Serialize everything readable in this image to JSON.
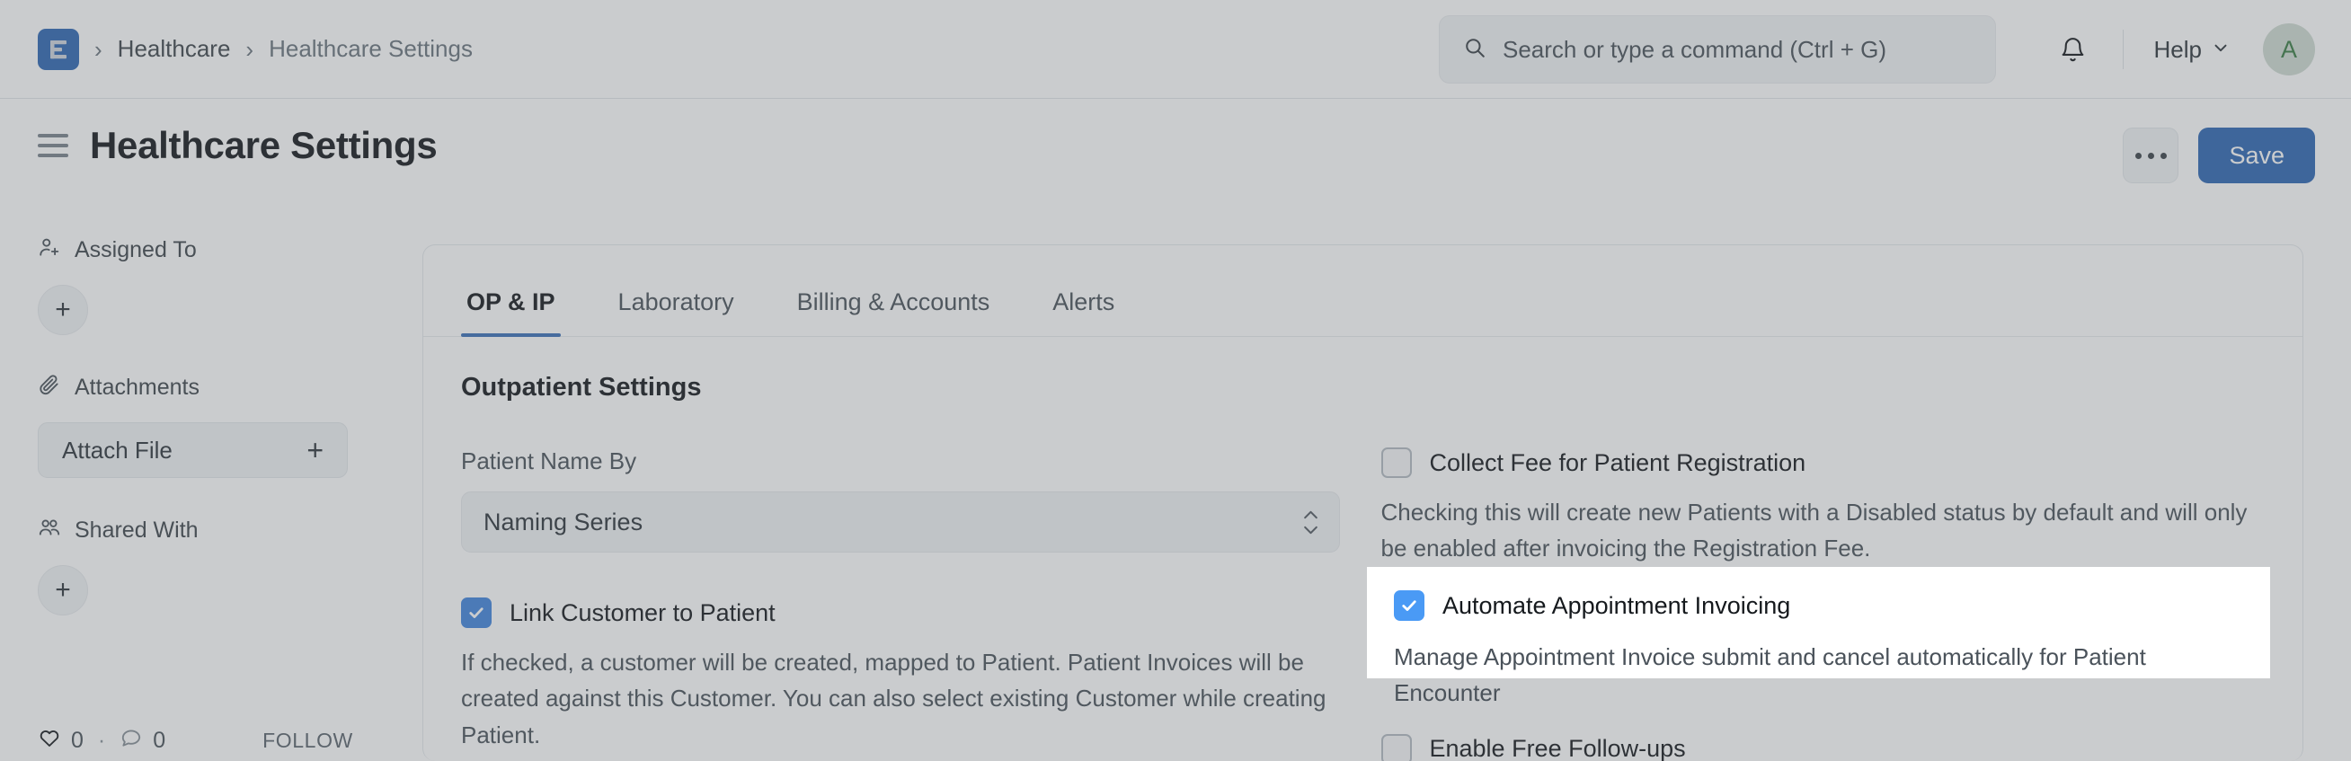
{
  "navbar": {
    "logo_icon": "erpnext-logo-icon",
    "breadcrumbs": [
      "Healthcare",
      "Healthcare Settings"
    ],
    "separator": "›",
    "search": {
      "icon": "search-icon",
      "placeholder": "Search or type a command (Ctrl + G)",
      "value": ""
    },
    "notifications_icon": "bell-icon",
    "help_label": "Help",
    "help_chevron_icon": "chevron-down-icon",
    "avatar_initial": "A"
  },
  "titlebar": {
    "sidebar_toggle_icon": "hamburger-menu-icon",
    "title": "Healthcare Settings",
    "more_icon": "ellipsis-icon",
    "save_label": "Save"
  },
  "sidebar": {
    "assigned_to": {
      "icon": "user-plus-icon",
      "label": "Assigned To",
      "add_label": "+"
    },
    "attachments": {
      "icon": "paperclip-icon",
      "label": "Attachments",
      "button_label": "Attach File",
      "button_plus": "+"
    },
    "shared_with": {
      "icon": "users-icon",
      "label": "Shared With",
      "add_label": "+"
    },
    "footer": {
      "like_icon": "heart-icon",
      "like_count": "0",
      "separator": "·",
      "comment_icon": "comment-icon",
      "comment_count": "0",
      "follow_label": "FOLLOW"
    }
  },
  "content": {
    "tabs": [
      {
        "label": "OP & IP",
        "active": true
      },
      {
        "label": "Laboratory",
        "active": false
      },
      {
        "label": "Billing & Accounts",
        "active": false
      },
      {
        "label": "Alerts",
        "active": false
      }
    ],
    "section_title": "Outpatient Settings",
    "left_column": {
      "patient_name_by": {
        "label": "Patient Name By",
        "value": "Naming Series",
        "chevron_icon": "chevron-updown-icon"
      },
      "link_customer": {
        "label": "Link Customer to Patient",
        "checked": true,
        "description": "If checked, a customer will be created, mapped to Patient. Patient Invoices will be created against this Customer. You can also select existing Customer while creating Patient."
      }
    },
    "right_column": {
      "collect_fee": {
        "label": "Collect Fee for Patient Registration",
        "checked": false,
        "description": "Checking this will create new Patients with a Disabled status by default and will only be enabled after invoicing the Registration Fee."
      },
      "automate_invoicing": {
        "label": "Automate Appointment Invoicing",
        "checked": true,
        "description": "Manage Appointment Invoice submit and cancel automatically for Patient Encounter",
        "highlighted": true
      },
      "free_followups": {
        "label": "Enable Free Follow-ups",
        "checked": false
      }
    }
  },
  "colors": {
    "brand_blue": "#2F67B4",
    "tab_underline": "#3b70b8",
    "checkbox_checked": "#4285dd",
    "checkbox_highlight": "#4a9af5",
    "avatar_bg": "#cfdbd2",
    "avatar_text": "#3a7d44",
    "dim_overlay": "rgba(93,100,106,0.33)"
  }
}
